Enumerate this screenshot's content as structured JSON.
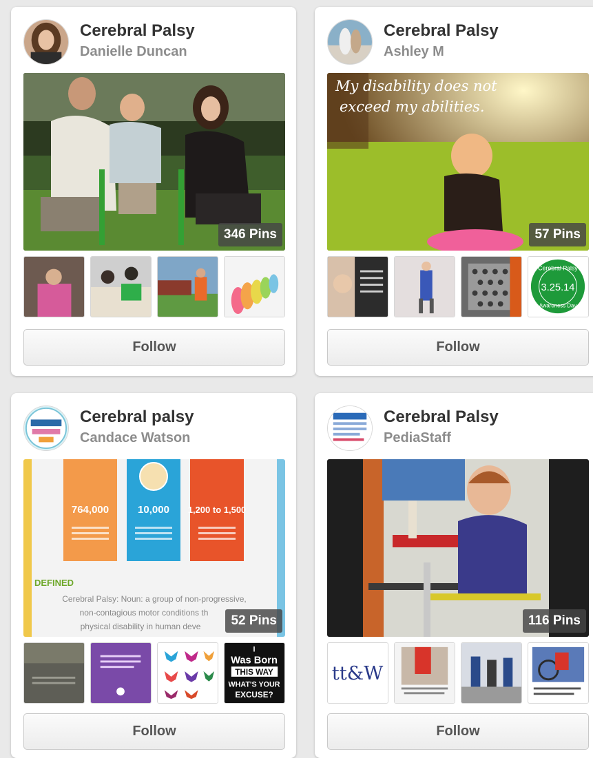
{
  "boards": [
    {
      "title": "Cerebral Palsy",
      "owner": "Danielle Duncan",
      "pin_count": "346 Pins",
      "follow_label": "Follow"
    },
    {
      "title": "Cerebral Palsy",
      "owner": "Ashley M",
      "pin_count": "57 Pins",
      "follow_label": "Follow",
      "cover_quote": [
        "My disability does not",
        "exceed my abilities."
      ],
      "thumb4_text": [
        "Cerebral Palsy",
        "3.25.14",
        "Awareness Day"
      ]
    },
    {
      "title": "Cerebral palsy",
      "owner": "Candace Watson",
      "pin_count": "52 Pins",
      "follow_label": "Follow",
      "infographic": {
        "stats": [
          "764,000",
          "10,000",
          "1,200 to 1,500"
        ],
        "defined_label": "DEFINED",
        "definition": [
          "Cerebral Palsy: Noun: a group of non-progressive,",
          "non-contagious motor conditions th",
          "physical disability in human deve"
        ]
      },
      "thumb4_text": [
        "I",
        "Was Born",
        "THIS WAY",
        "WHAT'S YOUR",
        "EXCUSE?"
      ]
    },
    {
      "title": "Cerebral Palsy",
      "owner": "PediaStaff",
      "pin_count": "116 Pins",
      "follow_label": "Follow",
      "thumb1_text": "tt&W"
    }
  ],
  "colors": {
    "title": "#333333",
    "owner": "#8c8c8c",
    "page_bg": "#e9e9e9",
    "card_bg": "#ffffff"
  }
}
